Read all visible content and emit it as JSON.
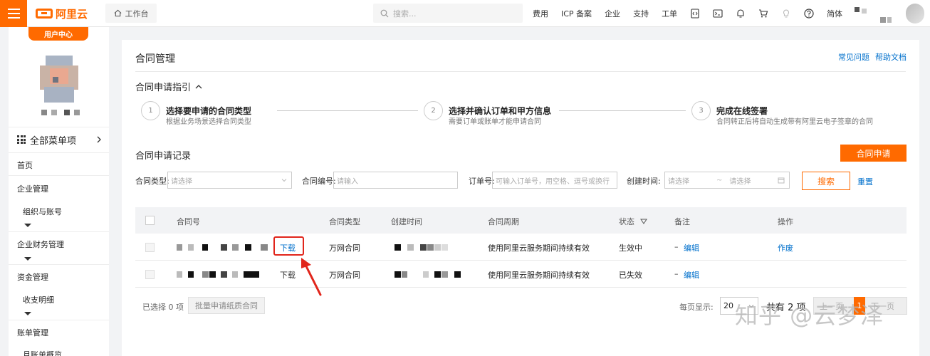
{
  "topbar": {
    "logo_text": "阿里云",
    "workbench_label": "工作台",
    "search_placeholder": "搜索...",
    "nav_items": [
      "费用",
      "ICP 备案",
      "企业",
      "支持",
      "工单"
    ],
    "lang_label": "简体"
  },
  "sidebar": {
    "user_center_label": "用户中心",
    "all_menu_label": "全部菜单项",
    "items": [
      {
        "label": "首页"
      },
      {
        "label": "企业管理"
      },
      {
        "label": "组织与账号"
      },
      {
        "label": "企业财务管理"
      },
      {
        "label": "资金管理"
      },
      {
        "label": "收支明细"
      },
      {
        "label": "账单管理"
      },
      {
        "label": "月账单概览"
      }
    ]
  },
  "main": {
    "title": "合同管理",
    "help_links": [
      "常见问题",
      "帮助文档"
    ],
    "guide_title": "合同申请指引",
    "steps": [
      {
        "num": "1",
        "title": "选择要申请的合同类型",
        "desc": "根据业务场景选择合同类型"
      },
      {
        "num": "2",
        "title": "选择并确认订单和甲方信息",
        "desc": "需要订单或账单才能申请合同"
      },
      {
        "num": "3",
        "title": "完成在线签署",
        "desc": "合同转正后将自动生成带有阿里云电子签章的合同"
      }
    ],
    "records_title": "合同申请记录",
    "apply_button": "合同申请",
    "filters": {
      "type_label": "合同类型:",
      "type_placeholder": "请选择",
      "number_label": "合同编号:",
      "number_placeholder": "请输入",
      "order_label": "订单号:",
      "order_placeholder": "可输入订单号，用空格、逗号或换行",
      "created_label": "创建时间:",
      "start_placeholder": "请选择",
      "end_placeholder": "请选择",
      "search_button": "搜索",
      "reset_link": "重置"
    },
    "table": {
      "headers": [
        "合同号",
        "合同类型",
        "创建时间",
        "合同周期",
        "状态",
        "备注",
        "操作"
      ],
      "rows": [
        {
          "download": "下载",
          "type": "万网合同",
          "period": "使用阿里云服务期间持续有效",
          "status": "生效中",
          "remark_dash": "–",
          "edit": "编辑",
          "action": "作废"
        },
        {
          "download": "下载",
          "type": "万网合同",
          "period": "使用阿里云服务期间持续有效",
          "status": "已失效",
          "remark_dash": "–",
          "edit": "编辑",
          "action": ""
        }
      ]
    },
    "footer": {
      "selected_text": "已选择 0 项",
      "batch_button": "批量申请纸质合同",
      "per_page_label": "每页显示:",
      "per_page_value": "20",
      "total_text": "共有 2 项",
      "prev_label": "上一页",
      "current_page": "1",
      "next_label": "下一页"
    },
    "watermark": "知乎 @云梦泽"
  },
  "colors": {
    "brand": "#ff6a00",
    "link": "#0070cc",
    "highlight": "#e1251b"
  }
}
